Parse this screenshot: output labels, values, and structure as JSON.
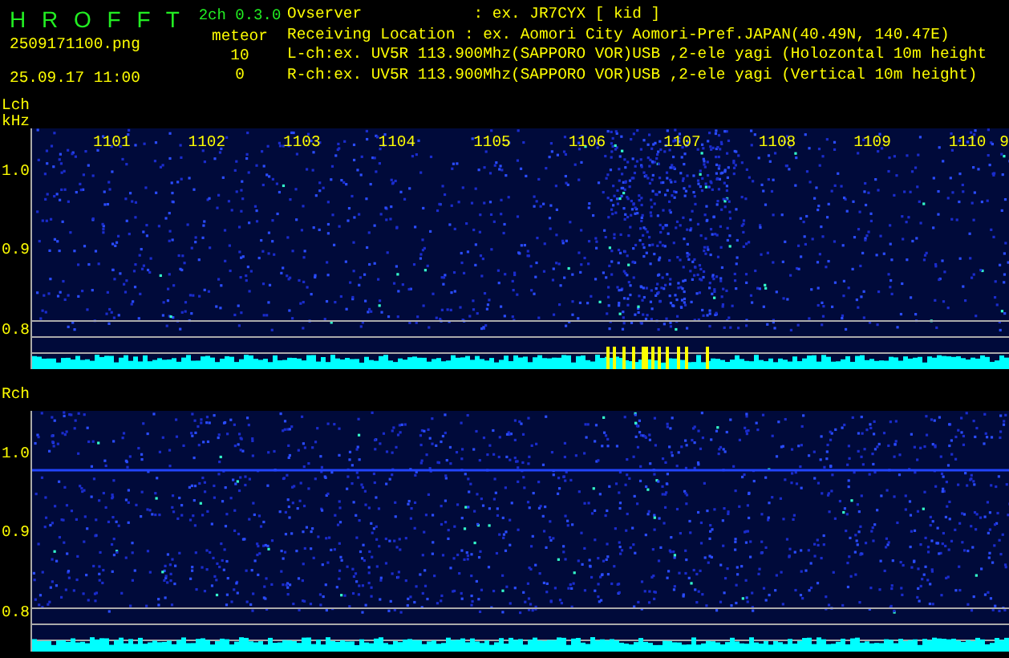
{
  "header": {
    "app_title": "H R O F F T",
    "version": "2ch 0.3.0",
    "filename": "2509171100.png",
    "datetime": "25.09.17 11:00",
    "counter_label": "meteor",
    "counts": [
      "10",
      "0"
    ],
    "info_lines": [
      "Ovserver            : ex. JR7CYX [ kid ]",
      "Receiving Location : ex. Aomori City Aomori-Pref.JAPAN(40.49N, 140.47E)",
      "L-ch:ex. UV5R 113.900Mhz(SAPPORO VOR)USB ,2-ele yagi (Holozontal 10m height",
      "R-ch:ex. UV5R 113.900Mhz(SAPPORO VOR)USB ,2-ele yagi (Vertical 10m height)"
    ]
  },
  "channels": [
    {
      "label": "Lch",
      "unit": "kHz",
      "y_labels": [
        "1.0",
        "0.9",
        "0.8"
      ],
      "freq_labels": [
        "1101",
        "1102",
        "1103",
        "1104",
        "1105",
        "1106",
        "1107",
        "1108",
        "1109",
        "1110"
      ],
      "edge_label": "9"
    },
    {
      "label": "Rch",
      "y_labels": [
        "1.0",
        "0.9",
        "0.8"
      ]
    }
  ]
}
